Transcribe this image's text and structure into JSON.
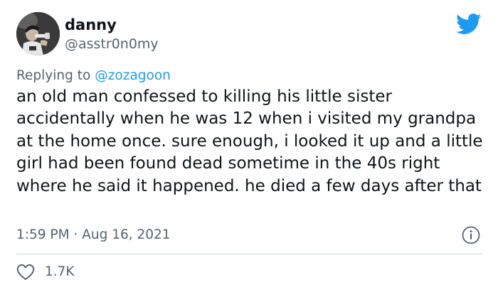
{
  "tweet": {
    "author": {
      "display_name": "danny",
      "handle": "@asstr0n0my",
      "avatar": "user-avatar-photo"
    },
    "replying_to": {
      "prefix": "Replying to",
      "mention": "@zozagoon"
    },
    "text": "an old man confessed to killing his little sister accidentally when he was 12 when i visited my grandpa at the home once. sure enough, i looked it up and a little girl had been found dead sometime in the 40s right where he said it happened. he died a few days after that",
    "timestamp": "1:59 PM · Aug 16, 2021",
    "likes": "1.7K"
  },
  "icons": {
    "brand": "twitter-bird-icon",
    "info": "info-icon",
    "like": "heart-icon"
  },
  "colors": {
    "brand_blue": "#1d9bf0",
    "text_primary": "#0f1419",
    "text_secondary": "#536471",
    "divider": "#cfd9de"
  }
}
